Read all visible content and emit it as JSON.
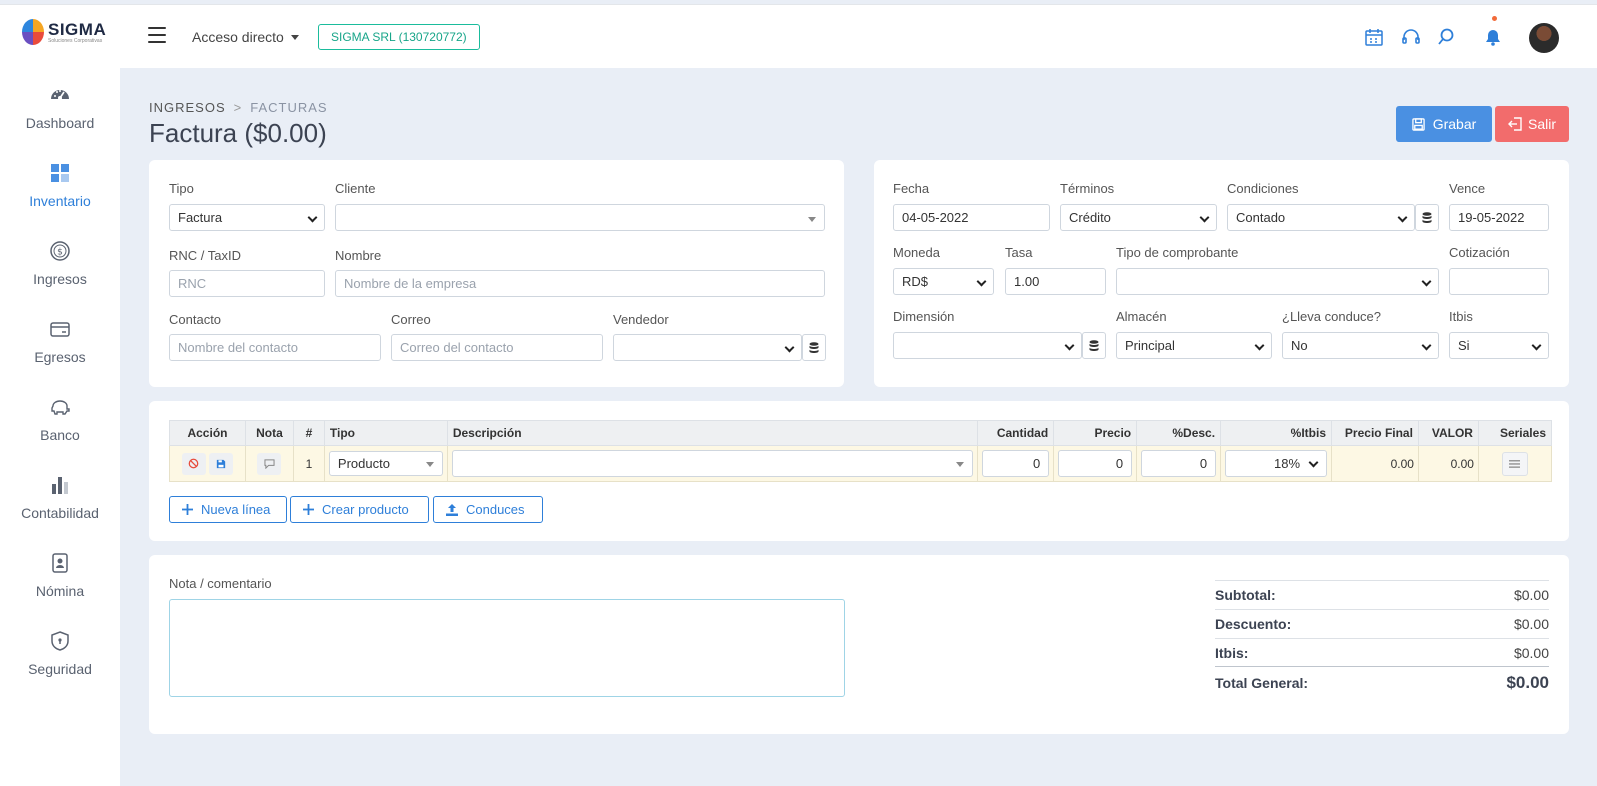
{
  "logo": {
    "text": "SIGMA",
    "subtitle": "Soluciones Corporativas"
  },
  "topbar": {
    "shortcut_label": "Acceso directo",
    "company": "SIGMA SRL (130720772)"
  },
  "sidebar": {
    "items": [
      {
        "label": "Dashboard",
        "icon": "gauge-icon"
      },
      {
        "label": "Inventario",
        "icon": "grid-icon",
        "active": true
      },
      {
        "label": "Ingresos",
        "icon": "dollar-coin-icon"
      },
      {
        "label": "Egresos",
        "icon": "card-icon"
      },
      {
        "label": "Banco",
        "icon": "piggy-bank-icon"
      },
      {
        "label": "Contabilidad",
        "icon": "bar-chart-icon"
      },
      {
        "label": "Nómina",
        "icon": "id-badge-icon"
      },
      {
        "label": "Seguridad",
        "icon": "shield-icon"
      }
    ]
  },
  "header": {
    "breadcrumb_root": "INGRESOS",
    "breadcrumb_current": "FACTURAS",
    "title": "Factura ($0.00)",
    "save_label": "Grabar",
    "exit_label": "Salir"
  },
  "left_form": {
    "tipo_label": "Tipo",
    "tipo_value": "Factura",
    "cliente_label": "Cliente",
    "cliente_value": "",
    "rnc_label": "RNC / TaxID",
    "rnc_placeholder": "RNC",
    "nombre_label": "Nombre",
    "nombre_placeholder": "Nombre de la empresa",
    "contacto_label": "Contacto",
    "contacto_placeholder": "Nombre del contacto",
    "correo_label": "Correo",
    "correo_placeholder": "Correo del contacto",
    "vendedor_label": "Vendedor",
    "vendedor_value": ""
  },
  "right_form": {
    "fecha_label": "Fecha",
    "fecha_value": "04-05-2022",
    "terminos_label": "Términos",
    "terminos_value": "Crédito",
    "condiciones_label": "Condiciones",
    "condiciones_value": "Contado",
    "vence_label": "Vence",
    "vence_value": "19-05-2022",
    "moneda_label": "Moneda",
    "moneda_value": "RD$",
    "tasa_label": "Tasa",
    "tasa_value": "1.00",
    "comprobante_label": "Tipo de comprobante",
    "comprobante_value": "",
    "cotizacion_label": "Cotización",
    "cotizacion_value": "",
    "dimension_label": "Dimensión",
    "dimension_value": "",
    "almacen_label": "Almacén",
    "almacen_value": "Principal",
    "conduce_label": "¿Lleva conduce?",
    "conduce_value": "No",
    "itbis_label": "Itbis",
    "itbis_value": "Si"
  },
  "lines_table": {
    "headers": [
      "Acción",
      "Nota",
      "#",
      "Tipo",
      "Descripción",
      "Cantidad",
      "Precio",
      "%Desc.",
      "%Itbis",
      "Precio Final",
      "VALOR",
      "Seriales"
    ],
    "row": {
      "num": "1",
      "tipo": "Producto",
      "descripcion": "",
      "cantidad": "0",
      "precio": "0",
      "descuento": "0",
      "itbis": "18%",
      "precio_final": "0.00",
      "valor": "0.00"
    }
  },
  "actions": {
    "new_line": "Nueva línea",
    "create_product": "Crear producto",
    "conduces": "Conduces"
  },
  "notes": {
    "label": "Nota / comentario",
    "value": ""
  },
  "totals": {
    "subtotal_label": "Subtotal:",
    "subtotal": "$0.00",
    "descuento_label": "Descuento:",
    "descuento": "$0.00",
    "itbis_label": "Itbis:",
    "itbis": "$0.00",
    "total_label": "Total General:",
    "total": "$0.00"
  },
  "colors": {
    "primary": "#4a90e2",
    "danger": "#f26c6c",
    "accent": "#2e7fd9",
    "teal": "#17a589"
  }
}
